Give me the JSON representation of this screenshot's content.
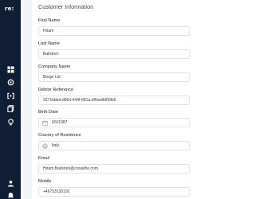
{
  "app": {
    "logo_text": "re:"
  },
  "sidebar": {
    "icons": [
      {
        "name": "dashboard-icon"
      },
      {
        "name": "settings-icon"
      },
      {
        "name": "integrations-icon"
      },
      {
        "name": "documents-icon"
      },
      {
        "name": "lightbulb-icon"
      },
      {
        "name": "user-icon"
      },
      {
        "name": "notifications-icon"
      }
    ]
  },
  "form": {
    "section_title": "Customer Information",
    "first_name": {
      "label": "First Name",
      "value": "Hiram"
    },
    "last_name": {
      "label": "Last Name",
      "value": "Balistreri"
    },
    "company_name": {
      "label": "Company Name",
      "value": "Berge Ltd"
    },
    "debtor_reference": {
      "label": "Debtor Reference",
      "value": "3271bbbd-d85d-444f-881a-bf5ee8df39b5"
    },
    "birth_date": {
      "label": "Birth Date",
      "value": "6/9/1987",
      "icon": "calendar-icon"
    },
    "country": {
      "label": "Country of Residence",
      "value": "Italy",
      "icon": "globe-icon"
    },
    "email": {
      "label": "Email",
      "value": "Hiram.Balistreri@conaithe.com"
    },
    "mobile": {
      "label": "Mobile",
      "value": "+46733130192"
    }
  },
  "colors": {
    "sidebar_bg": "#0f1e35",
    "main_bg": "#f4f5f7",
    "panel_bg": "#ffffff",
    "field_border": "#e1e3e6"
  }
}
